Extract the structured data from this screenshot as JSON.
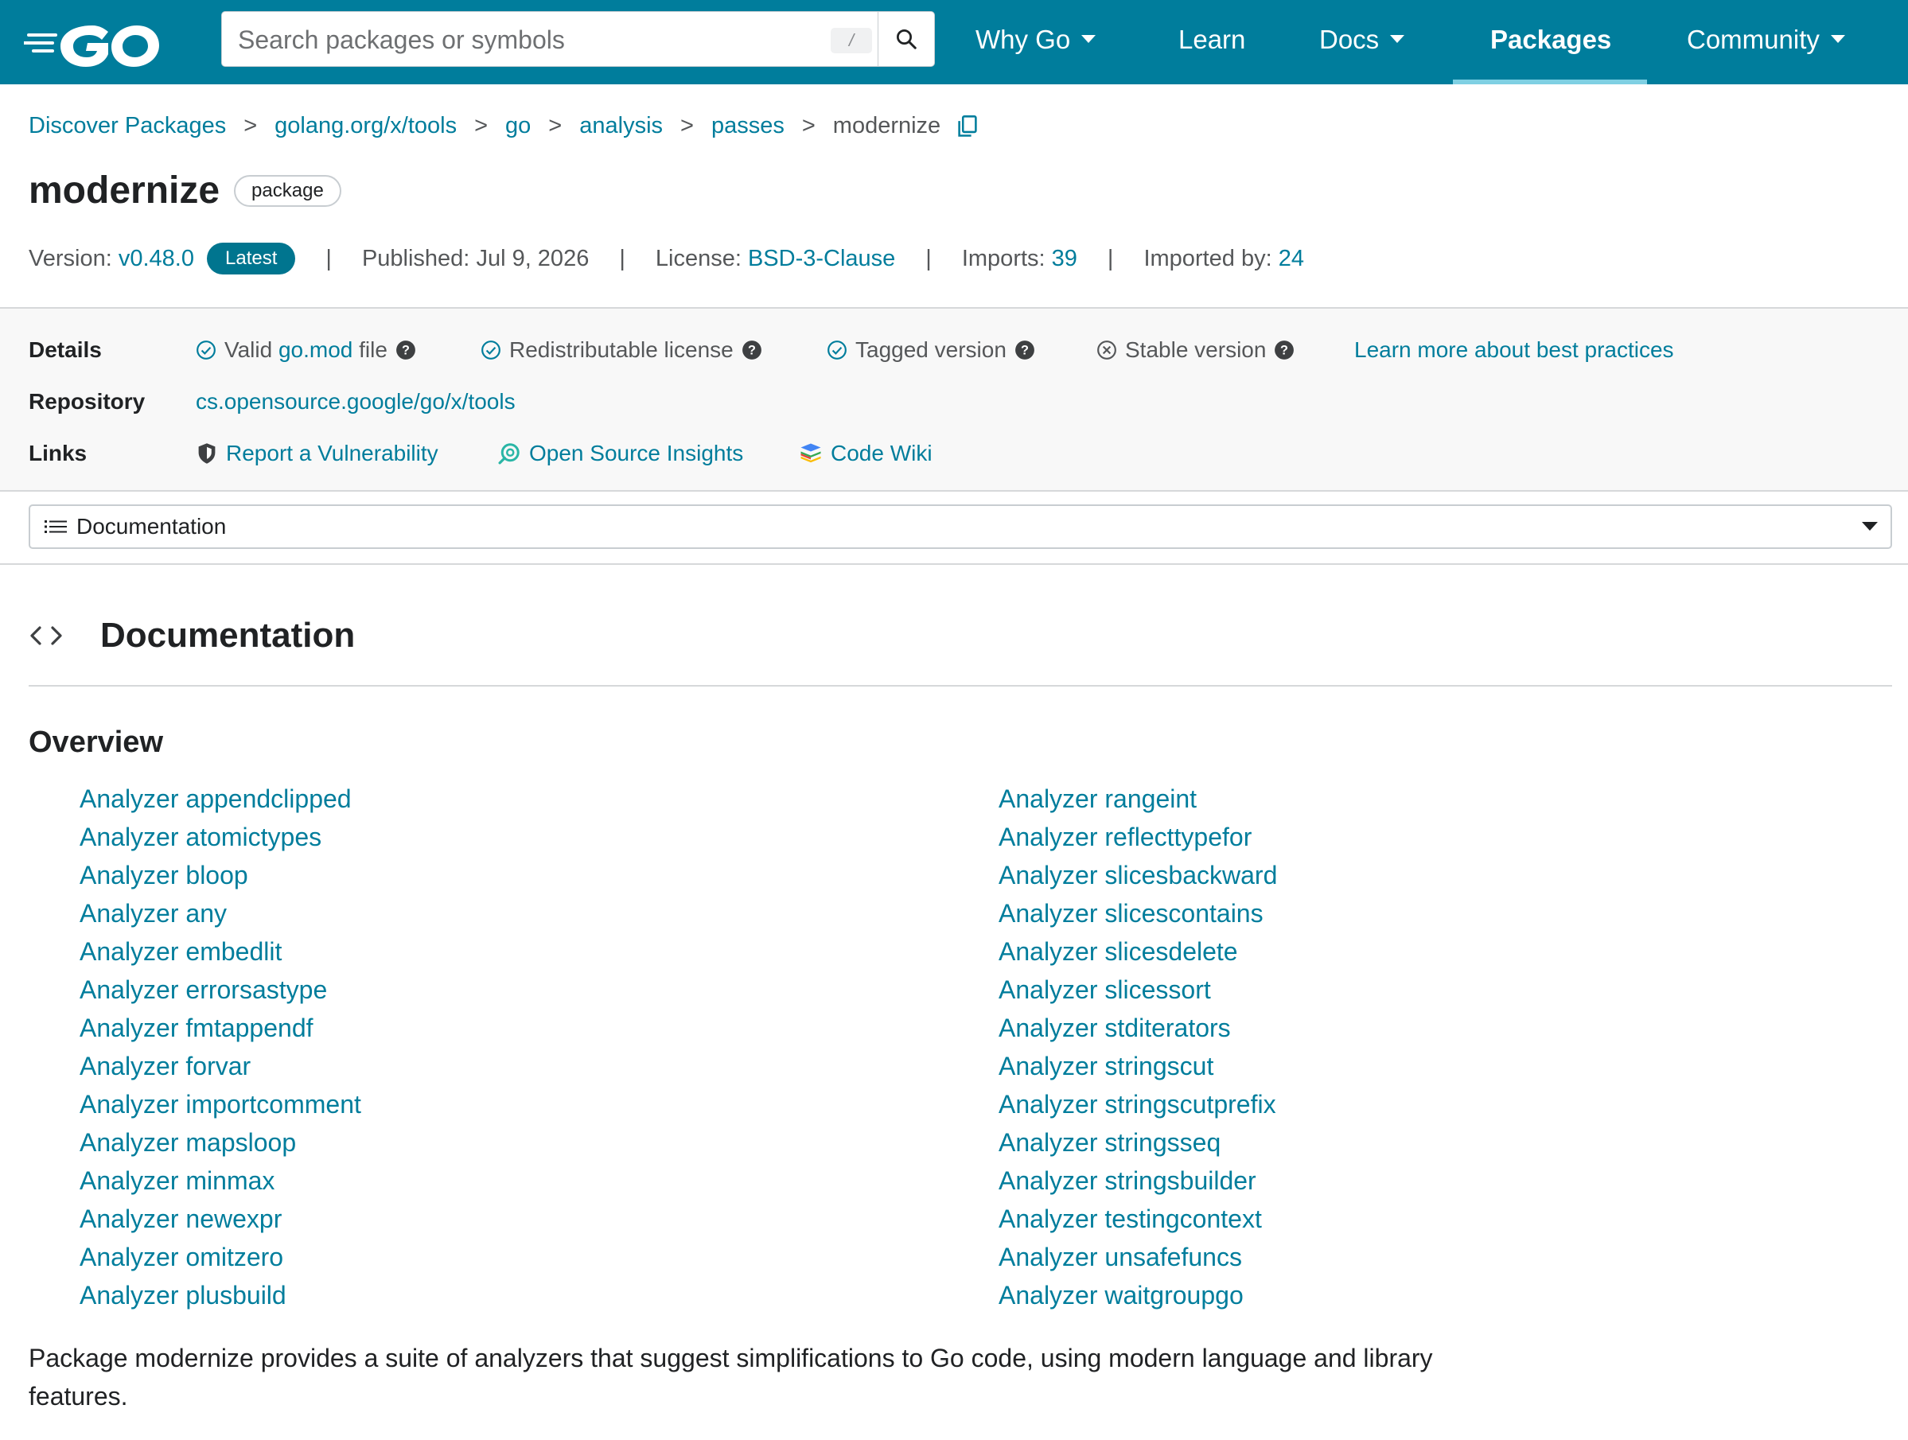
{
  "colors": {
    "brand": "#007d9c",
    "link": "#007d9c",
    "badge": "#00758f",
    "panel": "#f8f8f8"
  },
  "nav": {
    "search": {
      "placeholder": "Search packages or symbols",
      "shortcut": "/"
    },
    "items": [
      {
        "label": "Why Go",
        "dropdown": true
      },
      {
        "label": "Learn",
        "dropdown": false
      },
      {
        "label": "Docs",
        "dropdown": true
      },
      {
        "label": "Packages",
        "dropdown": false,
        "active": true
      },
      {
        "label": "Community",
        "dropdown": true
      }
    ]
  },
  "breadcrumb": {
    "items": [
      "Discover Packages",
      "golang.org/x/tools",
      "go",
      "analysis",
      "passes"
    ],
    "current": "modernize",
    "separator": ">"
  },
  "header": {
    "title": "modernize",
    "chip": "package",
    "version_label": "Version:",
    "version": "v0.48.0",
    "latest_badge": "Latest",
    "published_label": "Published:",
    "published": "Jul 9, 2026",
    "license_label": "License:",
    "license": "BSD-3-Clause",
    "imports_label": "Imports:",
    "imports": "39",
    "imported_by_label": "Imported by:",
    "imported_by": "24"
  },
  "details": {
    "label": "Details",
    "checks": [
      {
        "pre": "Valid ",
        "link": "go.mod",
        "post": " file",
        "state": "pass"
      },
      {
        "text": "Redistributable license",
        "state": "pass"
      },
      {
        "text": "Tagged version",
        "state": "pass"
      },
      {
        "text": "Stable version",
        "state": "fail"
      }
    ],
    "learn_more": "Learn more about best practices",
    "repository_label": "Repository",
    "repository": "cs.opensource.google/go/x/tools",
    "links_label": "Links",
    "links": [
      {
        "label": "Report a Vulnerability",
        "icon": "shield-icon"
      },
      {
        "label": "Open Source Insights",
        "icon": "insights-icon"
      },
      {
        "label": "Code Wiki",
        "icon": "code-wiki-icon"
      }
    ]
  },
  "jump": {
    "selected": "Documentation"
  },
  "documentation": {
    "heading": "Documentation",
    "overview": "Overview",
    "left_links": [
      "Analyzer appendclipped",
      "Analyzer atomictypes",
      "Analyzer bloop",
      "Analyzer any",
      "Analyzer embedlit",
      "Analyzer errorsastype",
      "Analyzer fmtappendf",
      "Analyzer forvar",
      "Analyzer importcomment",
      "Analyzer mapsloop",
      "Analyzer minmax",
      "Analyzer newexpr",
      "Analyzer omitzero",
      "Analyzer plusbuild"
    ],
    "right_links": [
      "Analyzer rangeint",
      "Analyzer reflecttypefor",
      "Analyzer slicesbackward",
      "Analyzer slicescontains",
      "Analyzer slicesdelete",
      "Analyzer slicessort",
      "Analyzer stditerators",
      "Analyzer stringscut",
      "Analyzer stringscutprefix",
      "Analyzer stringsseq",
      "Analyzer stringsbuilder",
      "Analyzer testingcontext",
      "Analyzer unsafefuncs",
      "Analyzer waitgroupgo"
    ],
    "description": "Package modernize provides a suite of analyzers that suggest simplifications to Go code, using modern language and library features."
  }
}
